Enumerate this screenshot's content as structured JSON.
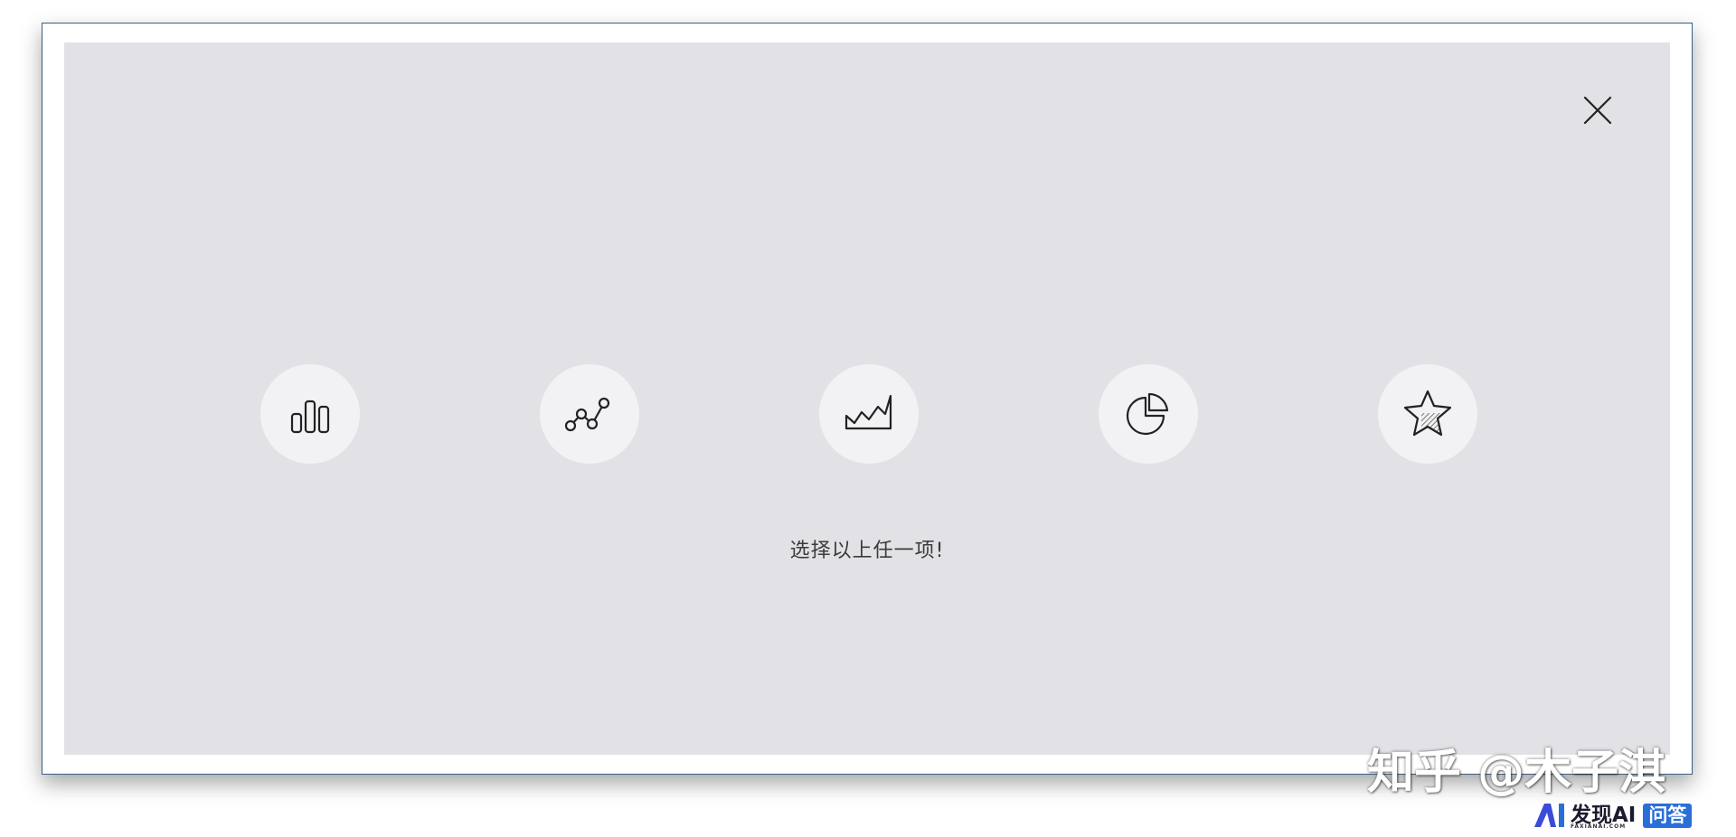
{
  "dialog": {
    "close_icon": "close-icon",
    "options": [
      {
        "icon": "bar-chart-icon"
      },
      {
        "icon": "line-chart-icon"
      },
      {
        "icon": "area-chart-icon"
      },
      {
        "icon": "pie-chart-icon"
      },
      {
        "icon": "star-icon"
      }
    ],
    "prompt": "选择以上任一项!"
  },
  "watermark": {
    "text": "知乎 @木子淇"
  },
  "brand": {
    "name": "发现AI",
    "sub": "FAXIANAI.COM",
    "badge": "问答"
  },
  "colors": {
    "panel_bg": "#e2e1e5",
    "option_bg": "#f2f2f4",
    "frame_border": "#3a5f86",
    "badge_bg": "#2a6ed8"
  }
}
